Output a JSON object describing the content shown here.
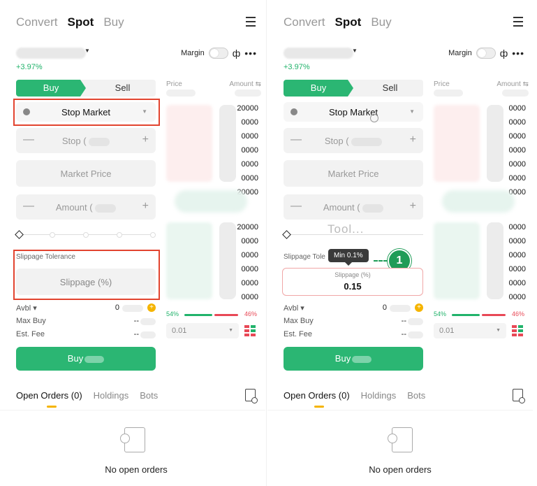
{
  "header": {
    "tabs": [
      "Convert",
      "Spot",
      "Buy"
    ],
    "active_tab": "Spot"
  },
  "pair": {
    "change": "+3.97%"
  },
  "controls": {
    "margin_label": "Margin"
  },
  "trade_tabs": {
    "buy": "Buy",
    "sell": "Sell"
  },
  "form": {
    "order_type": "Stop Market",
    "stop_label": "Stop (",
    "market_price": "Market Price",
    "amount_label": "Amount (",
    "slippage_title": "Slippage Tolerance",
    "slippage_title_truncated": "Slippage Tole",
    "slippage_placeholder": "Slippage (%)",
    "slippage_value": "0.15",
    "slippage_min_tooltip": "Min 0.1%",
    "tool_overlay": "Tool..."
  },
  "info": {
    "avbl_label": "Avbl ▾",
    "avbl_value": "0",
    "max_buy_label": "Max Buy",
    "max_buy_value": "--",
    "est_fee_label": "Est. Fee",
    "est_fee_value": "--"
  },
  "buy_button": "Buy",
  "orderbook": {
    "price_label": "Price",
    "amount_label": "Amount ⇆",
    "ask_amounts": [
      "20000",
      "0000",
      "0000",
      "0000",
      "0000",
      "0000",
      "20000"
    ],
    "bid_amounts": [
      "20000",
      "0000",
      "0000",
      "0000",
      "0000",
      "0000",
      "0000"
    ],
    "buy_ratio": "54%",
    "sell_ratio": "46%",
    "depth": "0.01"
  },
  "bottom": {
    "tabs": [
      "Open Orders (0)",
      "Holdings",
      "Bots"
    ],
    "empty_text": "No open orders"
  },
  "annotation": {
    "step_number": "1"
  },
  "colors": {
    "green": "#2bb673",
    "red": "#e84856",
    "highlight": "#e2442f",
    "step": "#1f9c57"
  }
}
